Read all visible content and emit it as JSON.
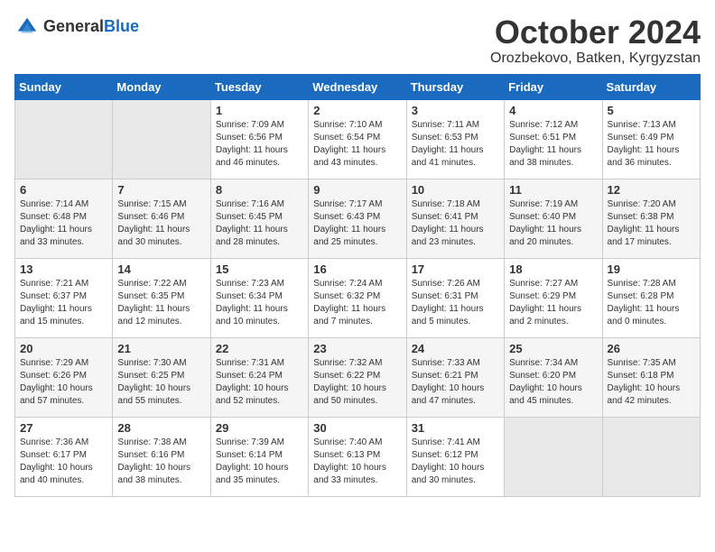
{
  "logo": {
    "general": "General",
    "blue": "Blue"
  },
  "title": "October 2024",
  "location": "Orozbekovo, Batken, Kyrgyzstan",
  "days_of_week": [
    "Sunday",
    "Monday",
    "Tuesday",
    "Wednesday",
    "Thursday",
    "Friday",
    "Saturday"
  ],
  "weeks": [
    [
      {
        "day": "",
        "sunrise": "",
        "sunset": "",
        "daylight": ""
      },
      {
        "day": "",
        "sunrise": "",
        "sunset": "",
        "daylight": ""
      },
      {
        "day": "1",
        "sunrise": "Sunrise: 7:09 AM",
        "sunset": "Sunset: 6:56 PM",
        "daylight": "Daylight: 11 hours and 46 minutes."
      },
      {
        "day": "2",
        "sunrise": "Sunrise: 7:10 AM",
        "sunset": "Sunset: 6:54 PM",
        "daylight": "Daylight: 11 hours and 43 minutes."
      },
      {
        "day": "3",
        "sunrise": "Sunrise: 7:11 AM",
        "sunset": "Sunset: 6:53 PM",
        "daylight": "Daylight: 11 hours and 41 minutes."
      },
      {
        "day": "4",
        "sunrise": "Sunrise: 7:12 AM",
        "sunset": "Sunset: 6:51 PM",
        "daylight": "Daylight: 11 hours and 38 minutes."
      },
      {
        "day": "5",
        "sunrise": "Sunrise: 7:13 AM",
        "sunset": "Sunset: 6:49 PM",
        "daylight": "Daylight: 11 hours and 36 minutes."
      }
    ],
    [
      {
        "day": "6",
        "sunrise": "Sunrise: 7:14 AM",
        "sunset": "Sunset: 6:48 PM",
        "daylight": "Daylight: 11 hours and 33 minutes."
      },
      {
        "day": "7",
        "sunrise": "Sunrise: 7:15 AM",
        "sunset": "Sunset: 6:46 PM",
        "daylight": "Daylight: 11 hours and 30 minutes."
      },
      {
        "day": "8",
        "sunrise": "Sunrise: 7:16 AM",
        "sunset": "Sunset: 6:45 PM",
        "daylight": "Daylight: 11 hours and 28 minutes."
      },
      {
        "day": "9",
        "sunrise": "Sunrise: 7:17 AM",
        "sunset": "Sunset: 6:43 PM",
        "daylight": "Daylight: 11 hours and 25 minutes."
      },
      {
        "day": "10",
        "sunrise": "Sunrise: 7:18 AM",
        "sunset": "Sunset: 6:41 PM",
        "daylight": "Daylight: 11 hours and 23 minutes."
      },
      {
        "day": "11",
        "sunrise": "Sunrise: 7:19 AM",
        "sunset": "Sunset: 6:40 PM",
        "daylight": "Daylight: 11 hours and 20 minutes."
      },
      {
        "day": "12",
        "sunrise": "Sunrise: 7:20 AM",
        "sunset": "Sunset: 6:38 PM",
        "daylight": "Daylight: 11 hours and 17 minutes."
      }
    ],
    [
      {
        "day": "13",
        "sunrise": "Sunrise: 7:21 AM",
        "sunset": "Sunset: 6:37 PM",
        "daylight": "Daylight: 11 hours and 15 minutes."
      },
      {
        "day": "14",
        "sunrise": "Sunrise: 7:22 AM",
        "sunset": "Sunset: 6:35 PM",
        "daylight": "Daylight: 11 hours and 12 minutes."
      },
      {
        "day": "15",
        "sunrise": "Sunrise: 7:23 AM",
        "sunset": "Sunset: 6:34 PM",
        "daylight": "Daylight: 11 hours and 10 minutes."
      },
      {
        "day": "16",
        "sunrise": "Sunrise: 7:24 AM",
        "sunset": "Sunset: 6:32 PM",
        "daylight": "Daylight: 11 hours and 7 minutes."
      },
      {
        "day": "17",
        "sunrise": "Sunrise: 7:26 AM",
        "sunset": "Sunset: 6:31 PM",
        "daylight": "Daylight: 11 hours and 5 minutes."
      },
      {
        "day": "18",
        "sunrise": "Sunrise: 7:27 AM",
        "sunset": "Sunset: 6:29 PM",
        "daylight": "Daylight: 11 hours and 2 minutes."
      },
      {
        "day": "19",
        "sunrise": "Sunrise: 7:28 AM",
        "sunset": "Sunset: 6:28 PM",
        "daylight": "Daylight: 11 hours and 0 minutes."
      }
    ],
    [
      {
        "day": "20",
        "sunrise": "Sunrise: 7:29 AM",
        "sunset": "Sunset: 6:26 PM",
        "daylight": "Daylight: 10 hours and 57 minutes."
      },
      {
        "day": "21",
        "sunrise": "Sunrise: 7:30 AM",
        "sunset": "Sunset: 6:25 PM",
        "daylight": "Daylight: 10 hours and 55 minutes."
      },
      {
        "day": "22",
        "sunrise": "Sunrise: 7:31 AM",
        "sunset": "Sunset: 6:24 PM",
        "daylight": "Daylight: 10 hours and 52 minutes."
      },
      {
        "day": "23",
        "sunrise": "Sunrise: 7:32 AM",
        "sunset": "Sunset: 6:22 PM",
        "daylight": "Daylight: 10 hours and 50 minutes."
      },
      {
        "day": "24",
        "sunrise": "Sunrise: 7:33 AM",
        "sunset": "Sunset: 6:21 PM",
        "daylight": "Daylight: 10 hours and 47 minutes."
      },
      {
        "day": "25",
        "sunrise": "Sunrise: 7:34 AM",
        "sunset": "Sunset: 6:20 PM",
        "daylight": "Daylight: 10 hours and 45 minutes."
      },
      {
        "day": "26",
        "sunrise": "Sunrise: 7:35 AM",
        "sunset": "Sunset: 6:18 PM",
        "daylight": "Daylight: 10 hours and 42 minutes."
      }
    ],
    [
      {
        "day": "27",
        "sunrise": "Sunrise: 7:36 AM",
        "sunset": "Sunset: 6:17 PM",
        "daylight": "Daylight: 10 hours and 40 minutes."
      },
      {
        "day": "28",
        "sunrise": "Sunrise: 7:38 AM",
        "sunset": "Sunset: 6:16 PM",
        "daylight": "Daylight: 10 hours and 38 minutes."
      },
      {
        "day": "29",
        "sunrise": "Sunrise: 7:39 AM",
        "sunset": "Sunset: 6:14 PM",
        "daylight": "Daylight: 10 hours and 35 minutes."
      },
      {
        "day": "30",
        "sunrise": "Sunrise: 7:40 AM",
        "sunset": "Sunset: 6:13 PM",
        "daylight": "Daylight: 10 hours and 33 minutes."
      },
      {
        "day": "31",
        "sunrise": "Sunrise: 7:41 AM",
        "sunset": "Sunset: 6:12 PM",
        "daylight": "Daylight: 10 hours and 30 minutes."
      },
      {
        "day": "",
        "sunrise": "",
        "sunset": "",
        "daylight": ""
      },
      {
        "day": "",
        "sunrise": "",
        "sunset": "",
        "daylight": ""
      }
    ]
  ]
}
